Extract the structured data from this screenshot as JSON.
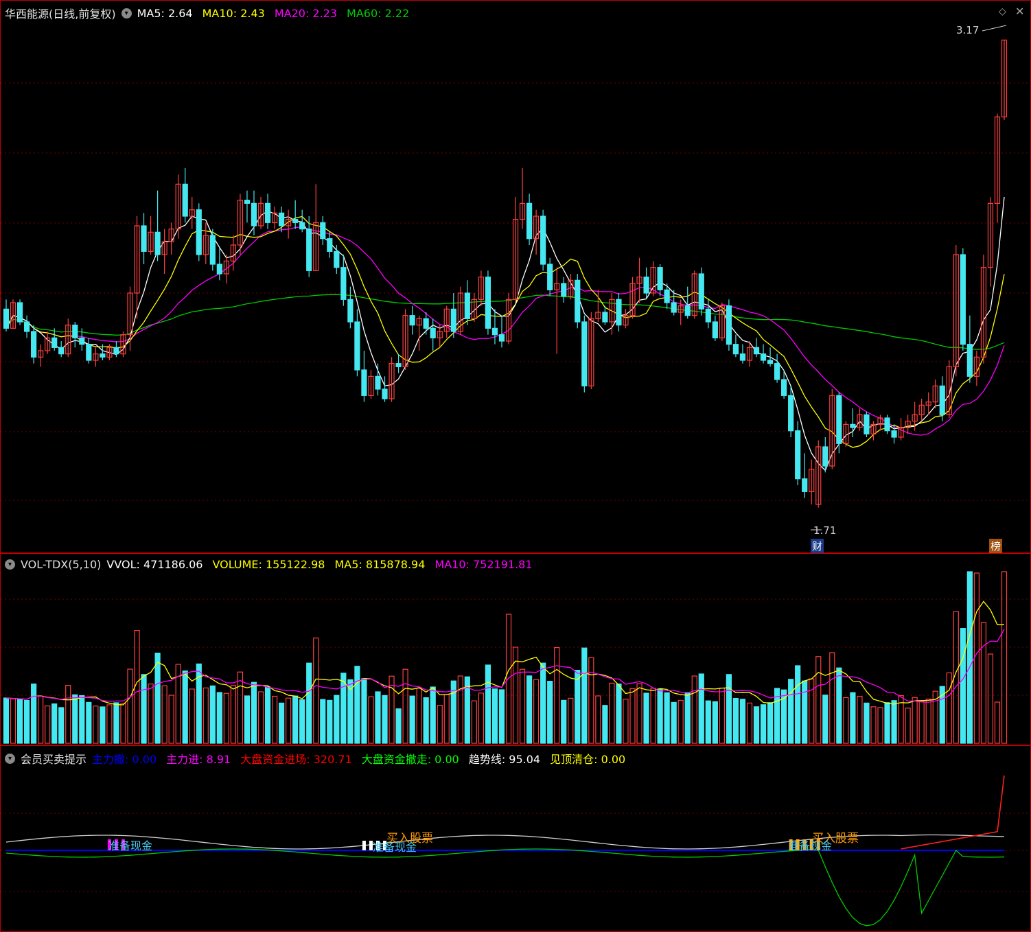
{
  "colors": {
    "up": "#ff4040",
    "down": "#45e8f0",
    "ma5": "#ffffff",
    "ma10": "#ffff00",
    "ma20": "#ff00ff",
    "ma60": "#00cc00",
    "grid": "#7a0000",
    "border": "#c00000"
  },
  "main": {
    "title": "华西能源(日线,前复权)",
    "ma": [
      {
        "label": "MA5: 2.64",
        "color": "#ffffff"
      },
      {
        "label": "MA10: 2.43",
        "color": "#ffff00"
      },
      {
        "label": "MA20: 2.23",
        "color": "#ff00ff"
      },
      {
        "label": "MA60: 2.22",
        "color": "#00cc00"
      }
    ],
    "high_mark": "3.17",
    "low_mark": "1.71",
    "badge_cai": "财",
    "badge_bang": "榜"
  },
  "volume": {
    "title": "VOL-TDX(5,10)",
    "items": [
      {
        "label": "VVOL: 471186.06",
        "color": "#ffffff"
      },
      {
        "label": "VOLUME: 155122.98",
        "color": "#ffff00"
      },
      {
        "label": "MA5: 815878.94",
        "color": "#ffff00"
      },
      {
        "label": "MA10: 752191.81",
        "color": "#ff00ff"
      }
    ]
  },
  "indicator": {
    "title": "会员买卖提示",
    "items": [
      {
        "label": "主力撤: 0.00",
        "color": "#0000ff"
      },
      {
        "label": "主力进: 8.91",
        "color": "#ff00ff"
      },
      {
        "label": "大盘资金进场: 320.71",
        "color": "#ff0000"
      },
      {
        "label": "大盘资金撤走: 0.00",
        "color": "#00ff00"
      },
      {
        "label": "趋势线: 95.04",
        "color": "#ffffff"
      },
      {
        "label": "见顶清仓: 0.00",
        "color": "#ffff00"
      }
    ],
    "annotations": {
      "buy1": "买入股票",
      "buy2": "买入股票",
      "cash1": "准备现金",
      "cash2": "准备现金",
      "cash3": "准备现金"
    }
  },
  "chart_data": {
    "type": "candlestick",
    "y_range": [
      1.6,
      3.25
    ],
    "candles": [
      [
        2.33,
        2.36,
        2.26,
        2.27
      ],
      [
        2.27,
        2.36,
        2.27,
        2.35
      ],
      [
        2.35,
        2.36,
        2.28,
        2.29
      ],
      [
        2.29,
        2.31,
        2.24,
        2.26
      ],
      [
        2.26,
        2.28,
        2.16,
        2.18
      ],
      [
        2.18,
        2.22,
        2.15,
        2.2
      ],
      [
        2.2,
        2.26,
        2.19,
        2.24
      ],
      [
        2.24,
        2.27,
        2.2,
        2.21
      ],
      [
        2.21,
        2.23,
        2.18,
        2.19
      ],
      [
        2.19,
        2.3,
        2.18,
        2.28
      ],
      [
        2.28,
        2.29,
        2.21,
        2.24
      ],
      [
        2.24,
        2.27,
        2.2,
        2.22
      ],
      [
        2.22,
        2.24,
        2.16,
        2.17
      ],
      [
        2.17,
        2.21,
        2.15,
        2.19
      ],
      [
        2.19,
        2.22,
        2.17,
        2.18
      ],
      [
        2.18,
        2.22,
        2.17,
        2.21
      ],
      [
        2.21,
        2.23,
        2.18,
        2.19
      ],
      [
        2.19,
        2.26,
        2.18,
        2.25
      ],
      [
        2.25,
        2.4,
        2.2,
        2.38
      ],
      [
        2.38,
        2.62,
        2.3,
        2.59
      ],
      [
        2.59,
        2.63,
        2.47,
        2.51
      ],
      [
        2.51,
        2.62,
        2.5,
        2.57
      ],
      [
        2.57,
        2.7,
        2.48,
        2.5
      ],
      [
        2.5,
        2.58,
        2.44,
        2.54
      ],
      [
        2.54,
        2.6,
        2.5,
        2.58
      ],
      [
        2.58,
        2.75,
        2.55,
        2.72
      ],
      [
        2.72,
        2.77,
        2.6,
        2.62
      ],
      [
        2.62,
        2.68,
        2.58,
        2.64
      ],
      [
        2.64,
        2.66,
        2.48,
        2.5
      ],
      [
        2.5,
        2.6,
        2.47,
        2.56
      ],
      [
        2.56,
        2.58,
        2.45,
        2.47
      ],
      [
        2.47,
        2.52,
        2.42,
        2.44
      ],
      [
        2.44,
        2.5,
        2.41,
        2.48
      ],
      [
        2.48,
        2.56,
        2.45,
        2.53
      ],
      [
        2.53,
        2.69,
        2.5,
        2.67
      ],
      [
        2.67,
        2.7,
        2.6,
        2.66
      ],
      [
        2.66,
        2.7,
        2.56,
        2.59
      ],
      [
        2.59,
        2.68,
        2.58,
        2.66
      ],
      [
        2.66,
        2.69,
        2.58,
        2.6
      ],
      [
        2.6,
        2.65,
        2.58,
        2.63
      ],
      [
        2.63,
        2.65,
        2.57,
        2.59
      ],
      [
        2.59,
        2.64,
        2.55,
        2.61
      ],
      [
        2.61,
        2.67,
        2.58,
        2.6
      ],
      [
        2.6,
        2.64,
        2.57,
        2.58
      ],
      [
        2.58,
        2.62,
        2.43,
        2.45
      ],
      [
        2.45,
        2.72,
        2.45,
        2.6
      ],
      [
        2.6,
        2.62,
        2.53,
        2.55
      ],
      [
        2.55,
        2.57,
        2.49,
        2.51
      ],
      [
        2.51,
        2.53,
        2.44,
        2.46
      ],
      [
        2.46,
        2.5,
        2.34,
        2.36
      ],
      [
        2.36,
        2.4,
        2.27,
        2.29
      ],
      [
        2.29,
        2.33,
        2.12,
        2.14
      ],
      [
        2.14,
        2.2,
        2.04,
        2.06
      ],
      [
        2.06,
        2.14,
        2.05,
        2.12
      ],
      [
        2.12,
        2.16,
        2.06,
        2.08
      ],
      [
        2.08,
        2.12,
        2.04,
        2.05
      ],
      [
        2.05,
        2.18,
        2.04,
        2.16
      ],
      [
        2.16,
        2.19,
        2.13,
        2.15
      ],
      [
        2.15,
        2.33,
        2.14,
        2.31
      ],
      [
        2.31,
        2.34,
        2.25,
        2.28
      ],
      [
        2.28,
        2.31,
        2.2,
        2.3
      ],
      [
        2.3,
        2.32,
        2.25,
        2.27
      ],
      [
        2.27,
        2.3,
        2.2,
        2.24
      ],
      [
        2.24,
        2.28,
        2.21,
        2.26
      ],
      [
        2.26,
        2.34,
        2.24,
        2.33
      ],
      [
        2.33,
        2.38,
        2.24,
        2.26
      ],
      [
        2.26,
        2.4,
        2.25,
        2.38
      ],
      [
        2.38,
        2.42,
        2.28,
        2.3
      ],
      [
        2.3,
        2.38,
        2.29,
        2.36
      ],
      [
        2.36,
        2.45,
        2.34,
        2.43
      ],
      [
        2.43,
        2.45,
        2.25,
        2.27
      ],
      [
        2.27,
        2.33,
        2.22,
        2.25
      ],
      [
        2.25,
        2.31,
        2.21,
        2.23
      ],
      [
        2.23,
        2.38,
        2.22,
        2.36
      ],
      [
        2.36,
        2.68,
        2.35,
        2.61
      ],
      [
        2.61,
        2.77,
        2.58,
        2.66
      ],
      [
        2.66,
        2.69,
        2.53,
        2.55
      ],
      [
        2.55,
        2.64,
        2.5,
        2.62
      ],
      [
        2.62,
        2.64,
        2.45,
        2.47
      ],
      [
        2.47,
        2.49,
        2.37,
        2.39
      ],
      [
        2.39,
        2.46,
        2.19,
        2.41
      ],
      [
        2.41,
        2.43,
        2.35,
        2.37
      ],
      [
        2.37,
        2.44,
        2.36,
        2.42
      ],
      [
        2.42,
        2.44,
        2.27,
        2.29
      ],
      [
        2.29,
        2.31,
        2.07,
        2.09
      ],
      [
        2.09,
        2.32,
        2.08,
        2.3
      ],
      [
        2.3,
        2.39,
        2.29,
        2.32
      ],
      [
        2.32,
        2.34,
        2.28,
        2.29
      ],
      [
        2.29,
        2.38,
        2.25,
        2.36
      ],
      [
        2.36,
        2.38,
        2.26,
        2.28
      ],
      [
        2.28,
        2.33,
        2.27,
        2.31
      ],
      [
        2.31,
        2.43,
        2.3,
        2.41
      ],
      [
        2.41,
        2.49,
        2.35,
        2.43
      ],
      [
        2.43,
        2.46,
        2.36,
        2.38
      ],
      [
        2.38,
        2.48,
        2.37,
        2.46
      ],
      [
        2.46,
        2.47,
        2.37,
        2.39
      ],
      [
        2.39,
        2.41,
        2.33,
        2.35
      ],
      [
        2.35,
        2.39,
        2.31,
        2.32
      ],
      [
        2.32,
        2.36,
        2.28,
        2.34
      ],
      [
        2.34,
        2.4,
        2.3,
        2.31
      ],
      [
        2.31,
        2.45,
        2.3,
        2.44
      ],
      [
        2.44,
        2.46,
        2.31,
        2.33
      ],
      [
        2.33,
        2.36,
        2.27,
        2.29
      ],
      [
        2.29,
        2.31,
        2.23,
        2.24
      ],
      [
        2.24,
        2.35,
        2.23,
        2.34
      ],
      [
        2.34,
        2.36,
        2.2,
        2.22
      ],
      [
        2.22,
        2.25,
        2.18,
        2.19
      ],
      [
        2.19,
        2.22,
        2.16,
        2.17
      ],
      [
        2.17,
        2.23,
        2.15,
        2.21
      ],
      [
        2.21,
        2.24,
        2.18,
        2.19
      ],
      [
        2.19,
        2.22,
        2.16,
        2.17
      ],
      [
        2.17,
        2.21,
        2.15,
        2.16
      ],
      [
        2.16,
        2.19,
        2.1,
        2.11
      ],
      [
        2.11,
        2.14,
        2.05,
        2.06
      ],
      [
        2.06,
        2.09,
        1.93,
        1.95
      ],
      [
        1.95,
        1.98,
        1.78,
        1.8
      ],
      [
        1.8,
        1.88,
        1.74,
        1.76
      ],
      [
        1.76,
        1.86,
        1.72,
        1.83
      ],
      [
        1.72,
        1.92,
        1.71,
        1.9
      ],
      [
        1.9,
        1.93,
        1.82,
        1.84
      ],
      [
        1.84,
        2.08,
        1.83,
        2.06
      ],
      [
        2.06,
        2.07,
        1.88,
        1.91
      ],
      [
        1.91,
        1.98,
        1.9,
        1.97
      ],
      [
        1.97,
        2.02,
        1.93,
        1.96
      ],
      [
        1.96,
        2.02,
        1.95,
        2.0
      ],
      [
        2.0,
        2.01,
        1.93,
        1.94
      ],
      [
        1.94,
        1.98,
        1.92,
        1.97
      ],
      [
        1.97,
        2.0,
        1.95,
        1.99
      ],
      [
        1.99,
        2.0,
        1.94,
        1.95
      ],
      [
        1.95,
        1.97,
        1.91,
        1.93
      ],
      [
        1.93,
        1.99,
        1.92,
        1.96
      ],
      [
        1.96,
        2.0,
        1.94,
        1.98
      ],
      [
        1.98,
        2.04,
        1.95,
        2.0
      ],
      [
        2.0,
        2.05,
        1.98,
        2.03
      ],
      [
        2.03,
        2.07,
        2.0,
        2.04
      ],
      [
        2.04,
        2.11,
        2.02,
        2.09
      ],
      [
        2.09,
        2.12,
        1.98,
        2.0
      ],
      [
        2.0,
        2.17,
        1.99,
        2.15
      ],
      [
        2.15,
        2.53,
        2.12,
        2.5
      ],
      [
        2.5,
        2.52,
        2.2,
        2.22
      ],
      [
        2.22,
        2.31,
        2.1,
        2.12
      ],
      [
        2.12,
        2.2,
        2.09,
        2.18
      ],
      [
        2.18,
        2.5,
        2.16,
        2.46
      ],
      [
        2.46,
        2.68,
        2.4,
        2.66
      ],
      [
        2.66,
        2.94,
        2.6,
        2.93
      ],
      [
        2.93,
        3.17,
        2.92,
        3.17
      ]
    ]
  }
}
